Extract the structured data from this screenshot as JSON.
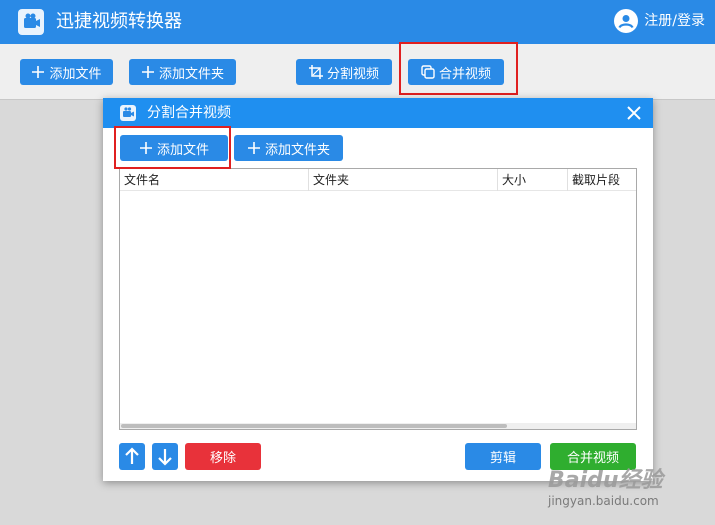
{
  "app": {
    "title": "迅捷视频转换器",
    "login_label": "注册/登录"
  },
  "toolbar": {
    "add_file": "添加文件",
    "add_folder": "添加文件夹",
    "split_video": "分割视频",
    "merge_video": "合并视频"
  },
  "dialog": {
    "title": "分割合并视频",
    "add_file": "添加文件",
    "add_folder": "添加文件夹",
    "columns": [
      "文件名",
      "文件夹",
      "大小",
      "截取片段"
    ],
    "remove_label": "移除",
    "edit_label": "剪辑",
    "merge_label": "合并视频"
  },
  "watermark": {
    "brand": "Baidu经验",
    "url": "jingyan.baidu.com"
  },
  "colors": {
    "primary": "#2a8ae6",
    "danger": "#e8323a",
    "success": "#2fae2f",
    "highlight": "#e02020"
  }
}
